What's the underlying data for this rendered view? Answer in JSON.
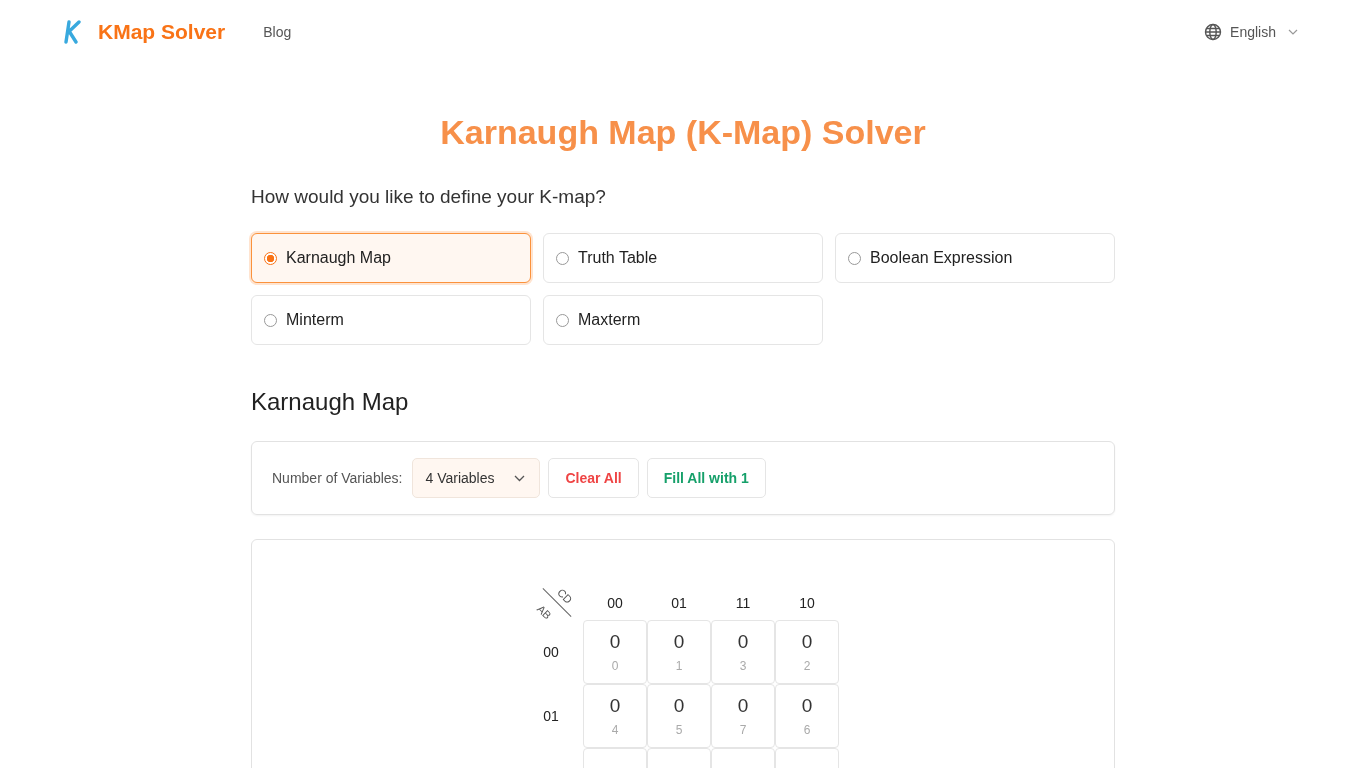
{
  "header": {
    "brand": "KMap Solver",
    "nav": [
      "Blog"
    ],
    "language": "English"
  },
  "title": "Karnaugh Map (K-Map) Solver",
  "question": "How would you like to define your K-map?",
  "options": [
    {
      "label": "Karnaugh Map",
      "selected": true
    },
    {
      "label": "Truth Table",
      "selected": false
    },
    {
      "label": "Boolean Expression",
      "selected": false
    },
    {
      "label": "Minterm",
      "selected": false
    },
    {
      "label": "Maxterm",
      "selected": false
    }
  ],
  "section_title": "Karnaugh Map",
  "controls": {
    "variables_label": "Number of Variables:",
    "variables_value": "4 Variables",
    "clear_button": "Clear All",
    "fill_button": "Fill All with 1"
  },
  "kmap": {
    "col_var": "CD",
    "row_var": "AB",
    "col_headers": [
      "00",
      "01",
      "11",
      "10"
    ],
    "rows": [
      {
        "label": "00",
        "cells": [
          {
            "value": "0",
            "index": "0"
          },
          {
            "value": "0",
            "index": "1"
          },
          {
            "value": "0",
            "index": "3"
          },
          {
            "value": "0",
            "index": "2"
          }
        ]
      },
      {
        "label": "01",
        "cells": [
          {
            "value": "0",
            "index": "4"
          },
          {
            "value": "0",
            "index": "5"
          },
          {
            "value": "0",
            "index": "7"
          },
          {
            "value": "0",
            "index": "6"
          }
        ]
      }
    ]
  }
}
